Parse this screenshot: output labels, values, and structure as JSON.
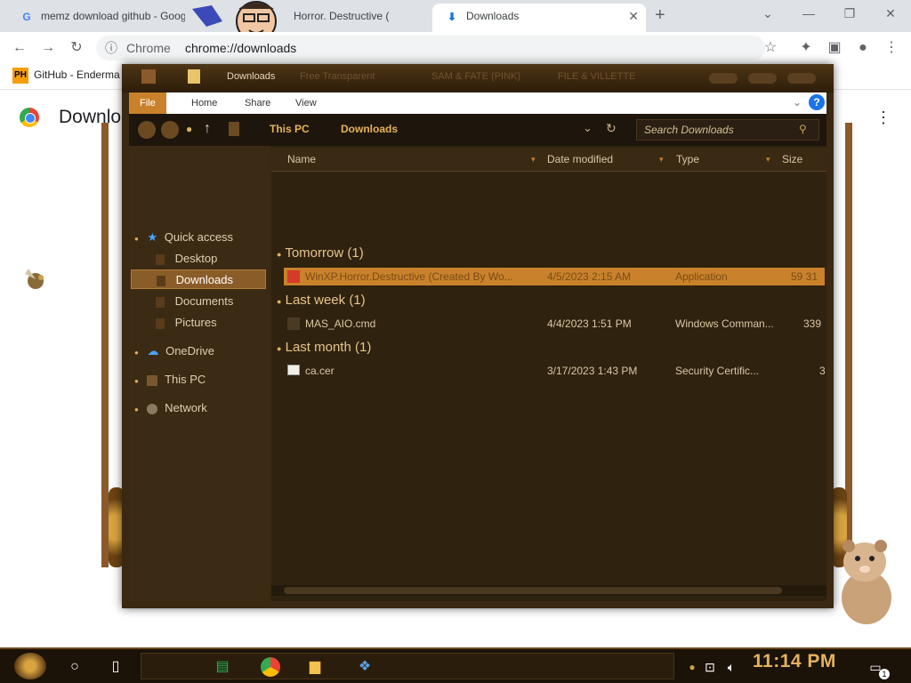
{
  "browser": {
    "tabs": [
      {
        "label": "memz download github - Goog",
        "icon": "google-g-icon",
        "active": false
      },
      {
        "label": "Horror. Destructive (",
        "icon": "page-icon",
        "active": false
      },
      {
        "label": "Downloads",
        "icon": "download-icon",
        "active": true
      }
    ],
    "new_tab": "+",
    "address": "chrome://downloads",
    "address_prefix": "Chrome",
    "bookmarks": [
      {
        "label": "GitHub - Enderma",
        "icon": "ph-icon",
        "badge": "PH"
      }
    ]
  },
  "downloads_page": {
    "title": "Downloads"
  },
  "explorer": {
    "title": "Downloads",
    "titlebar_items": [
      "Free Transparent",
      "SAM & FATE (PINK)",
      "FILE & VILLETTE"
    ],
    "ribbon_tabs": [
      "File",
      "Home",
      "Share",
      "View"
    ],
    "breadcrumb": [
      "This PC",
      "Downloads"
    ],
    "search_placeholder": "Search Downloads",
    "nav": [
      {
        "label": "Quick access",
        "icon": "star-icon"
      },
      {
        "label": "Desktop",
        "icon": "desktop-icon"
      },
      {
        "label": "Downloads",
        "icon": "downloads-folder-icon",
        "selected": true
      },
      {
        "label": "Documents",
        "icon": "documents-icon"
      },
      {
        "label": "Pictures",
        "icon": "pictures-icon"
      },
      {
        "label": "OneDrive",
        "icon": "cloud-icon"
      },
      {
        "label": "This PC",
        "icon": "computer-icon"
      },
      {
        "label": "Network",
        "icon": "network-icon"
      }
    ],
    "columns": [
      "Name",
      "Date modified",
      "Type",
      "Size"
    ],
    "groups": [
      {
        "label": "Tomorrow (1)",
        "files": [
          {
            "name": "WinXP.Horror.Destructive (Created By Wo...",
            "date": "4/5/2023 2:15 AM",
            "type": "Application",
            "size": "59 31",
            "selected": true
          }
        ]
      },
      {
        "label": "Last week (1)",
        "files": [
          {
            "name": "MAS_AIO.cmd",
            "date": "4/4/2023 1:51 PM",
            "type": "Windows Comman...",
            "size": "339"
          }
        ]
      },
      {
        "label": "Last month (1)",
        "files": [
          {
            "name": "ca.cer",
            "date": "3/17/2023 1:43 PM",
            "type": "Security Certific...",
            "size": "3"
          }
        ]
      }
    ]
  },
  "taskbar": {
    "clock": "11:14 PM",
    "apps": [
      "cortana-icon",
      "task-view-icon",
      "spotify-icon",
      "chrome-icon",
      "file-explorer-icon",
      "app-icon"
    ],
    "notification_count": "1"
  },
  "colors": {
    "chrome_strip": "#dee1e6",
    "explorer_bg": "#2f220f",
    "accent_orange": "#c9822b",
    "clock": "#e6b25a"
  }
}
